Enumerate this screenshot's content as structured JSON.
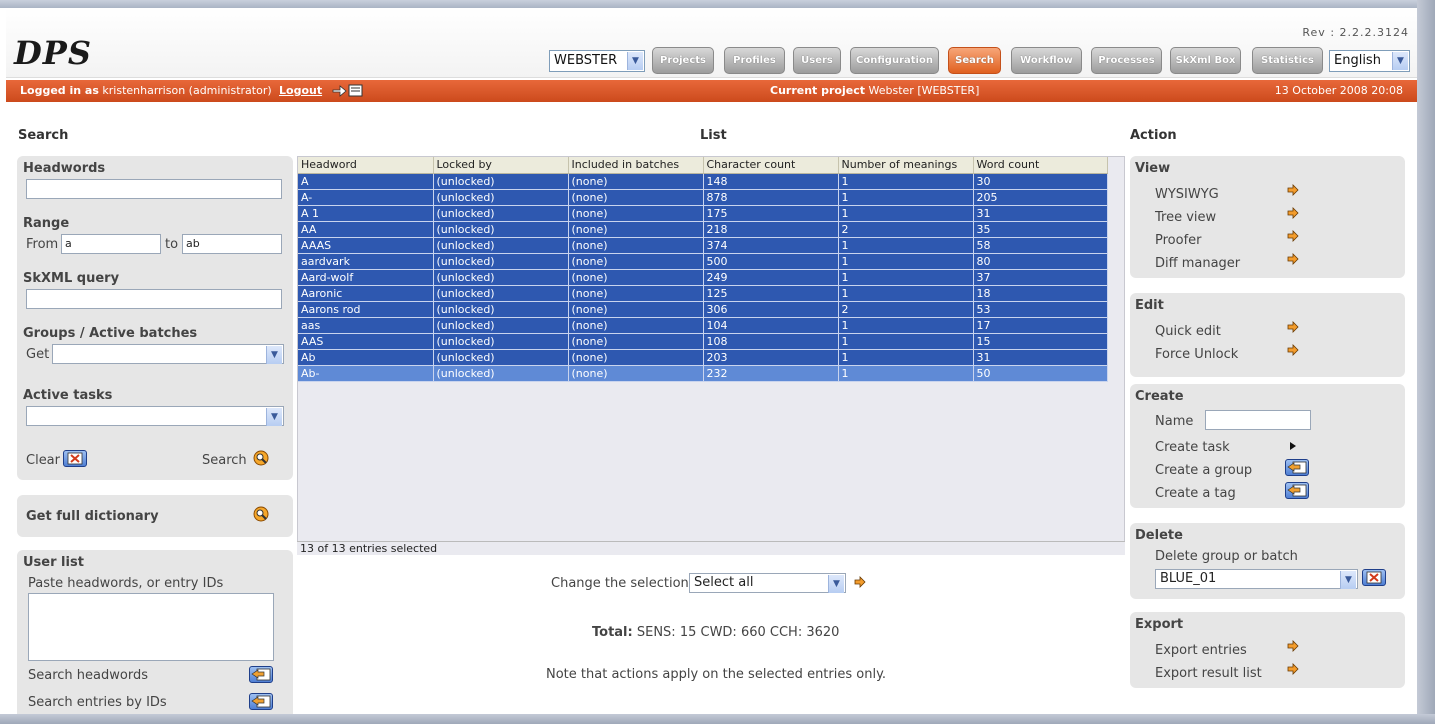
{
  "header": {
    "logo": "DPS",
    "rev": "Rev : 2.2.2.3124",
    "project_select": "WEBSTER",
    "nav": [
      "Projects",
      "Profiles",
      "Users",
      "Configuration",
      "Search",
      "Workflow",
      "Processes",
      "SkXml Box",
      "Statistics"
    ],
    "active_nav": "Search",
    "language": "English"
  },
  "status": {
    "logged_label": "Logged in as",
    "user": "kristenharrison (administrator)",
    "logout": "Logout",
    "project_label": "Current project",
    "project": "Webster [WEBSTER]",
    "date": "13 October 2008 20:08"
  },
  "titles": {
    "search": "Search",
    "list": "List",
    "action": "Action"
  },
  "search": {
    "headwords_label": "Headwords",
    "headwords_value": "",
    "range_label": "Range",
    "from_label": "From",
    "from_value": "a",
    "to_label": "to",
    "to_value": "ab",
    "skxml_label": "SkXML query",
    "groups_label": "Groups / Active batches",
    "get_label": "Get",
    "active_tasks_label": "Active tasks",
    "clear_label": "Clear",
    "search_label": "Search"
  },
  "full_dict": {
    "label": "Get full dictionary"
  },
  "user_list": {
    "title": "User list",
    "hint": "Paste headwords, or entry IDs",
    "search_headwords": "Search headwords",
    "search_ids": "Search entries by IDs"
  },
  "list": {
    "columns": [
      "Headword",
      "Locked by",
      "Included in batches",
      "Character count",
      "Number of meanings",
      "Word count"
    ],
    "rows": [
      [
        "A",
        "(unlocked)",
        "(none)",
        "148",
        "1",
        "30"
      ],
      [
        "A-",
        "(unlocked)",
        "(none)",
        "878",
        "1",
        "205"
      ],
      [
        "A 1",
        "(unlocked)",
        "(none)",
        "175",
        "1",
        "31"
      ],
      [
        "AA",
        "(unlocked)",
        "(none)",
        "218",
        "2",
        "35"
      ],
      [
        "AAAS",
        "(unlocked)",
        "(none)",
        "374",
        "1",
        "58"
      ],
      [
        "aardvark",
        "(unlocked)",
        "(none)",
        "500",
        "1",
        "80"
      ],
      [
        "Aard-wolf",
        "(unlocked)",
        "(none)",
        "249",
        "1",
        "37"
      ],
      [
        "Aaronic",
        "(unlocked)",
        "(none)",
        "125",
        "1",
        "18"
      ],
      [
        "Aarons rod",
        "(unlocked)",
        "(none)",
        "306",
        "2",
        "53"
      ],
      [
        "aas",
        "(unlocked)",
        "(none)",
        "104",
        "1",
        "17"
      ],
      [
        "AAS",
        "(unlocked)",
        "(none)",
        "108",
        "1",
        "15"
      ],
      [
        "Ab",
        "(unlocked)",
        "(none)",
        "203",
        "1",
        "31"
      ],
      [
        "Ab-",
        "(unlocked)",
        "(none)",
        "232",
        "1",
        "50"
      ]
    ],
    "footer": "13 of 13 entries selected",
    "change_label": "Change the selection",
    "change_value": "Select all",
    "total_label": "Total:",
    "total_value": "SENS: 15 CWD: 660 CCH: 3620",
    "note": "Note that actions apply on the selected entries only."
  },
  "actions": {
    "view": {
      "title": "View",
      "items": [
        "WYSIWYG",
        "Tree view",
        "Proofer",
        "Diff manager"
      ]
    },
    "edit": {
      "title": "Edit",
      "items": [
        "Quick edit",
        "Force Unlock"
      ]
    },
    "create": {
      "title": "Create",
      "name_label": "Name",
      "items": [
        "Create task",
        "Create a group",
        "Create a tag"
      ]
    },
    "delete": {
      "title": "Delete",
      "label": "Delete group or batch",
      "value": "BLUE_01"
    },
    "export": {
      "title": "Export",
      "items": [
        "Export entries",
        "Export result list"
      ]
    }
  }
}
